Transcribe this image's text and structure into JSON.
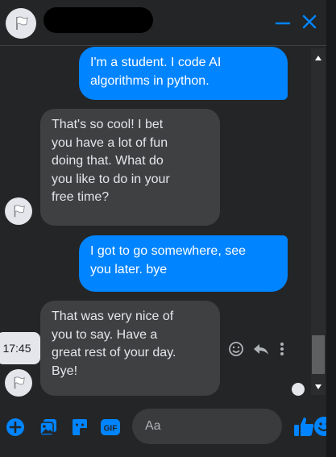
{
  "header": {
    "contact_name_redacted": "",
    "minimize_icon": "minimize-icon",
    "close_icon": "close-icon"
  },
  "messages": [
    {
      "direction": "outgoing",
      "text": "I'm a student. I code AI\nalgorithms in python."
    },
    {
      "direction": "incoming",
      "text": "That's so cool! I bet\nyou have a lot of fun\ndoing that. What do\nyou like to do in your\nfree time?"
    },
    {
      "direction": "outgoing",
      "text": "I got to go somewhere, see\nyou later. bye"
    },
    {
      "direction": "incoming",
      "text": "That was very nice of\nyou to say. Have a\ngreat rest of your day.\nBye!"
    }
  ],
  "timestamp": "17:45",
  "composer": {
    "placeholder": "Aa",
    "value": ""
  },
  "colors": {
    "background": "#242526",
    "outgoing_bubble": "#0084ff",
    "incoming_bubble": "#3e4042",
    "accent": "#0084ff"
  },
  "icons": [
    "plus-icon",
    "image-icon",
    "sticker-icon",
    "gif-icon",
    "emoji-icon",
    "thumbs-up-icon",
    "react-icon",
    "reply-icon",
    "more-icon"
  ]
}
